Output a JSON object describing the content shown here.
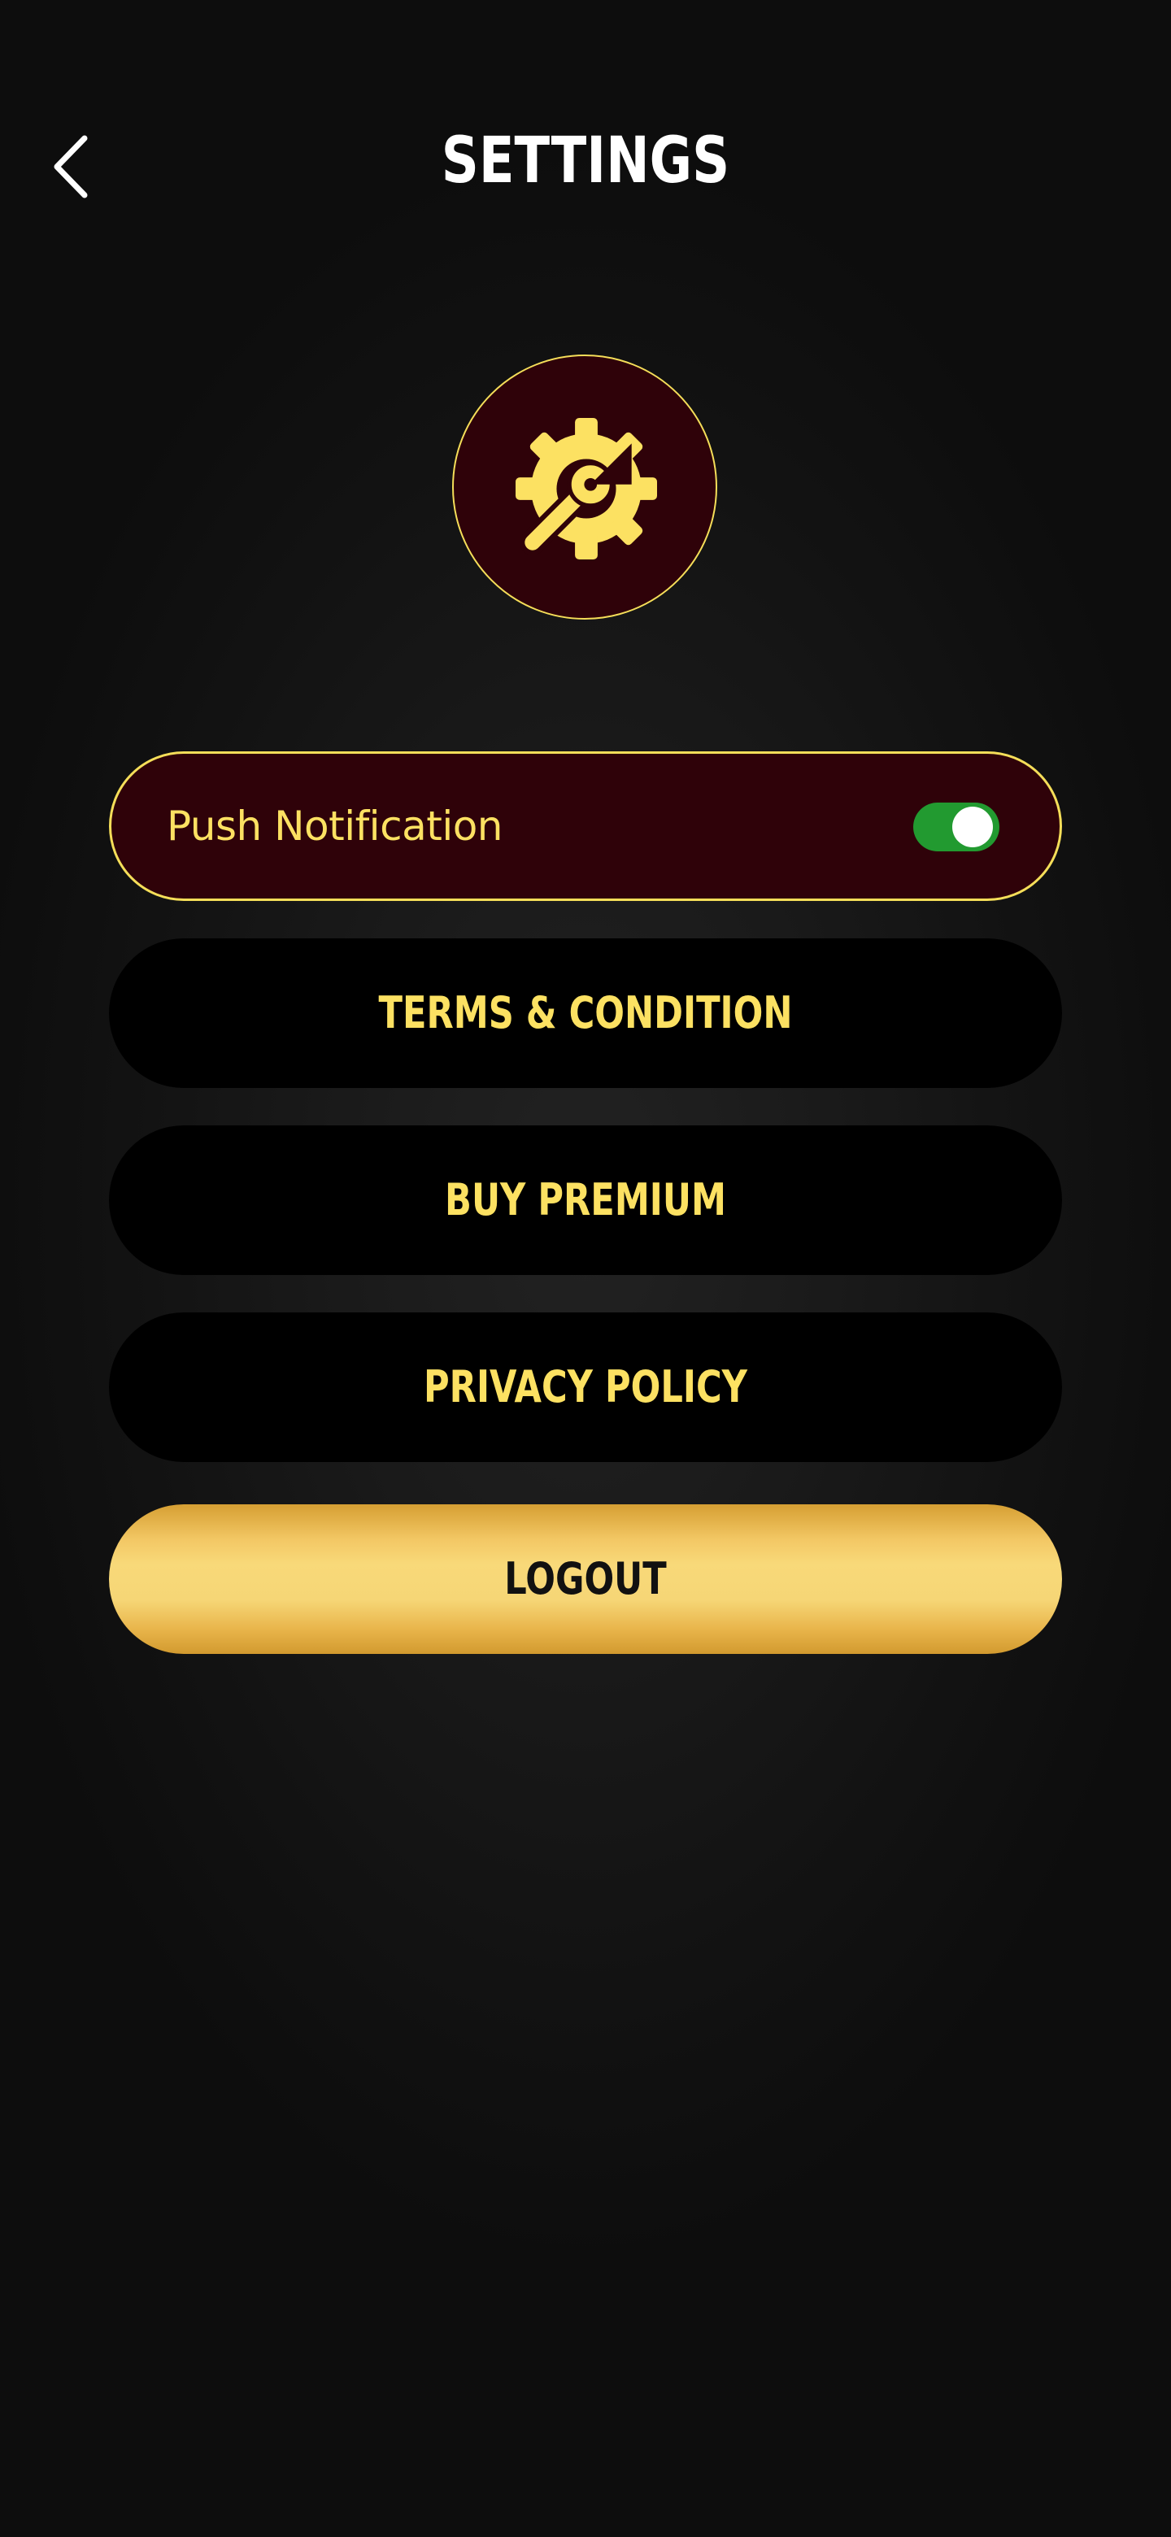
{
  "header": {
    "title": "SETTINGS",
    "back_icon": "chevron-left-icon"
  },
  "emblem": {
    "icon": "gear-wrench-icon"
  },
  "settings": {
    "push_notification": {
      "label": "Push Notification",
      "enabled": true
    },
    "terms_label": "TERMS & CONDITION",
    "premium_label": "BUY PREMIUM",
    "privacy_label": "PRIVACY POLICY",
    "logout_label": "LOGOUT"
  },
  "colors": {
    "background": "#111111",
    "accent_yellow": "#fce162",
    "maroon": "#2f0209",
    "toggle_on": "#229a30",
    "gold_button": "#f6d676"
  }
}
